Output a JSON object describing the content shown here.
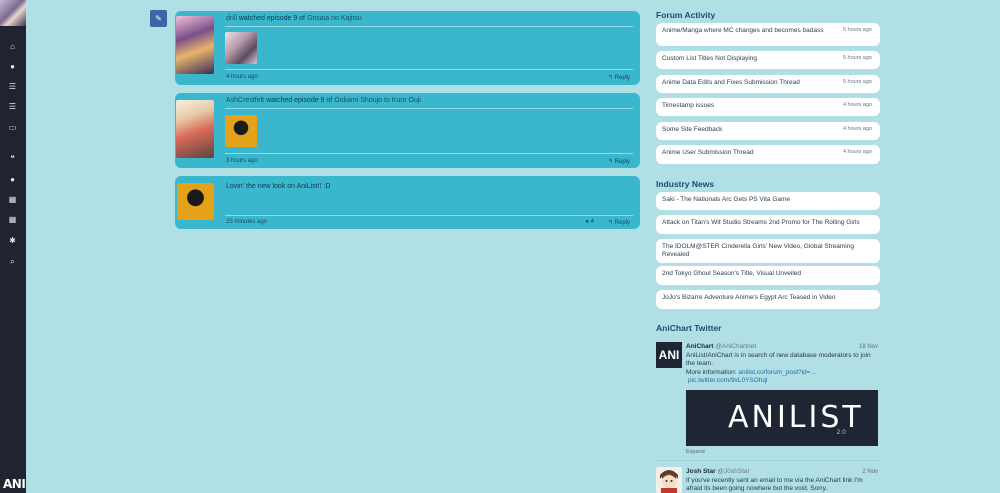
{
  "sidebar": {
    "logo": "ANI",
    "icons": [
      "home-icon",
      "user-icon",
      "list-icon",
      "list-alt-icon",
      "inbox-icon",
      "comments-icon",
      "comment-icon",
      "grid-icon",
      "grid-alt-icon",
      "gear-icon",
      "search-icon"
    ]
  },
  "feed": [
    {
      "user": "drill",
      "action": "watched episode 9 of",
      "title": "Grisaia no Kajitsu",
      "time": "4 hours ago",
      "reply": "Reply"
    },
    {
      "user": "AshCrestfelt",
      "action": "watched episode 9 of",
      "title": "Ookami Shoujo to Kuro Ouji",
      "time": "3 hours ago",
      "reply": "Reply"
    },
    {
      "text": "Lovin' the new look on AniList!! :D",
      "time": "25 minutes ago",
      "comments": "4",
      "reply": "Reply"
    }
  ],
  "forum": {
    "title": "Forum Activity",
    "items": [
      {
        "text": "Anime/Manga where MC changes and becomes badass",
        "ago": "5 hours ago"
      },
      {
        "text": "Custom List Titles Not Displaying",
        "ago": "5 hours ago"
      },
      {
        "text": "Anime Data Edits and Fixes Submission Thread",
        "ago": "5 hours ago"
      },
      {
        "text": "Timestamp issues",
        "ago": "4 hours ago"
      },
      {
        "text": "Some Site Feedback",
        "ago": "4 hours ago"
      },
      {
        "text": "Anime User Submission Thread",
        "ago": "4 hours ago"
      }
    ]
  },
  "news": {
    "title": "Industry News",
    "items": [
      "Saki - The Nationals Arc Gets PS Vita Game",
      "Attack on Titan's Wit Studio Streams 2nd Promo for The Rolling Girls",
      "The IDOLM@STER Cinderella Girls' New Video, Global Streaming Revealed",
      "2nd Tokyo Ghoul Season's Title, Visual Unveiled",
      "JoJo's Bizarre Adventure Anime's Egypt Arc Teased in Video"
    ]
  },
  "twitter": {
    "title": "AniChart Twitter",
    "tweets": [
      {
        "name": "AniChart",
        "handle": "@AniChartnet",
        "date": "18 Nov",
        "avatar": "ANI",
        "body": "AniList/AniChart is in search of new database moderators to join the team.",
        "more": "More information:",
        "link1": "anilist.co/forum_post?id=...",
        "link2": "pic.twitter.com/9xL0YSOhql",
        "banner": "ANILIST",
        "banner_sub": "2.0",
        "expand": "Expand"
      },
      {
        "name": "Josh Star",
        "handle": "@J0shStar",
        "date": "2 Nov",
        "body": "If you've recently sent an email to me via the AniChart link I'm afraid its been going nowhere but the void. Sorry."
      }
    ]
  }
}
